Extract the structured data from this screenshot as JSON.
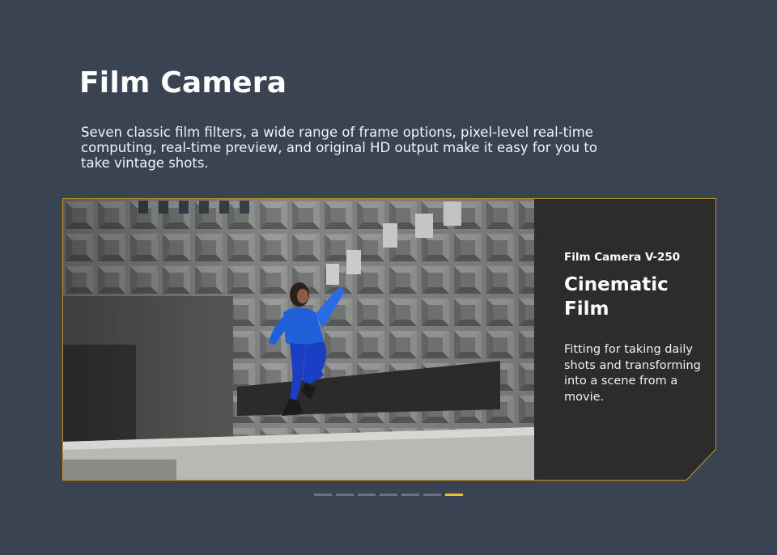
{
  "section": {
    "title": "Film Camera",
    "description": "Seven classic film filters, a wide range of frame options, pixel-level real-time computing, real-time preview, and original HD output make it easy for you to take vintage shots."
  },
  "slide": {
    "model": "Film Camera V-250",
    "headline": "Cinematic Film",
    "body": "Fitting for taking daily shots and transforming into a scene from a movie."
  },
  "carousel": {
    "count": 7,
    "active_index": 6
  },
  "colors": {
    "background": "#3a4352",
    "panel": "#2c2c2c",
    "accent": "#e4c12a",
    "dot_inactive": "#6a727e"
  }
}
